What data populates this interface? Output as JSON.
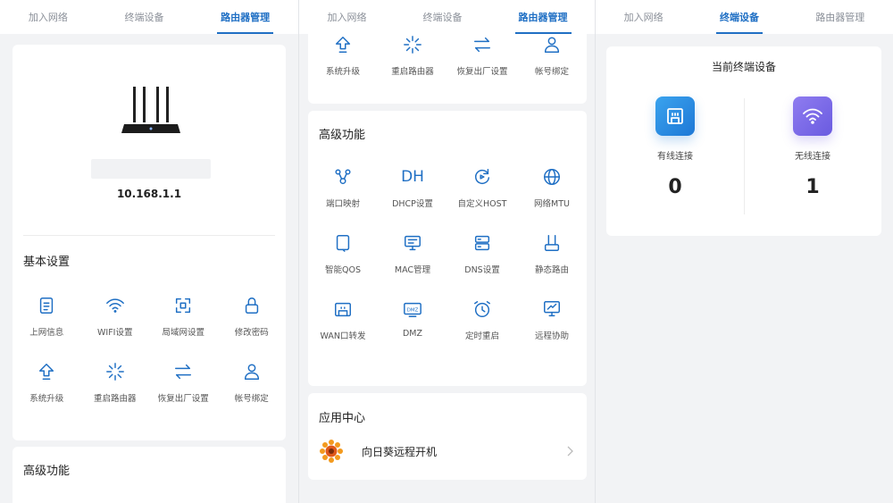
{
  "tabs": [
    "加入网络",
    "终端设备",
    "路由器管理"
  ],
  "screen1": {
    "ip": "10.168.1.1",
    "basic_title": "基本设置",
    "basic_items": [
      "上网信息",
      "WIFI设置",
      "局域网设置",
      "修改密码",
      "系统升级",
      "重启路由器",
      "恢复出厂设置",
      "帐号绑定"
    ],
    "advanced_title": "高级功能"
  },
  "screen2": {
    "top_items": [
      "系统升级",
      "重启路由器",
      "恢复出厂设置",
      "帐号绑定"
    ],
    "advanced_title": "高级功能",
    "advanced_items": [
      "端口映射",
      "DHCP设置",
      "自定义HOST",
      "网络MTU",
      "智能QOS",
      "MAC管理",
      "DNS设置",
      "静态路由",
      "WAN口转发",
      "DMZ",
      "定时重启",
      "远程协助"
    ],
    "dhcp_glyph": "DH",
    "dmz_glyph": "DMZ",
    "app_title": "应用中心",
    "app_name": "向日葵远程开机"
  },
  "screen3": {
    "title": "当前终端设备",
    "wired_label": "有线连接",
    "wired_count": "0",
    "wireless_label": "无线连接",
    "wireless_count": "1"
  },
  "colors": {
    "accent": "#1f6fc4",
    "wired": "#2a8ae2",
    "wireless": "#7b6ae8"
  }
}
